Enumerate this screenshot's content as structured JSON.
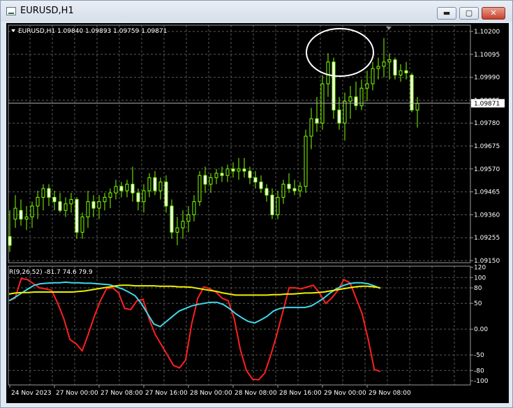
{
  "window": {
    "title": "EURUSD,H1",
    "minimize_label": "▬",
    "maximize_label": "▢",
    "close_label": "✕"
  },
  "icons": {
    "app": "chart-window-icon",
    "dropdown": "triangle-down-icon"
  },
  "colors": {
    "background": "#000000",
    "grid": "#5a5a5a",
    "candle": "#7fff00",
    "text": "#ffffff",
    "rsi_fast": "#ff2020",
    "rsi_mid": "#40d8e8",
    "rsi_slow": "#f0f000",
    "annotation": "#ffffff"
  },
  "main_chart": {
    "symbol_header": "EURUSD,H1  1.09840 1.09893 1.09759 1.09871",
    "current_price_label": "1.09871",
    "current_price": 1.09871,
    "price_labels": [
      "1.10200",
      "1.10095",
      "1.09990",
      "1.09885",
      "1.09780",
      "1.09675",
      "1.09570",
      "1.09465",
      "1.09360",
      "1.09255",
      "1.09150"
    ],
    "price_values": [
      1.102,
      1.10095,
      1.0999,
      1.09885,
      1.0978,
      1.09675,
      1.0957,
      1.09465,
      1.0936,
      1.09255,
      1.0915
    ],
    "ylim": [
      1.0915,
      1.102
    ]
  },
  "indicator": {
    "header": "R(9,26,52) -81.7 74.6 79.9",
    "level_labels": [
      "120",
      "100",
      "80",
      "50",
      "0.00",
      "-50",
      "-80",
      "-100"
    ],
    "level_values": [
      120,
      100,
      80,
      50,
      0,
      -50,
      -80,
      -100
    ],
    "ylim": [
      -108,
      122
    ]
  },
  "time_axis": {
    "labels": [
      "24 Nov 2023",
      "27 Nov 00:00",
      "27 Nov 08:00",
      "27 Nov 16:00",
      "28 Nov 00:00",
      "28 Nov 08:00",
      "28 Nov 16:00",
      "29 Nov 00:00",
      "29 Nov 08:00"
    ]
  },
  "chart_data": [
    {
      "type": "candlestick",
      "title": "EURUSD,H1",
      "ylim": [
        1.0915,
        1.102
      ],
      "candles": [
        {
          "o": 1.0926,
          "h": 1.0938,
          "l": 1.0919,
          "c": 1.0922
        },
        {
          "o": 1.0934,
          "h": 1.0945,
          "l": 1.093,
          "c": 1.0939
        },
        {
          "o": 1.0938,
          "h": 1.0943,
          "l": 1.0931,
          "c": 1.0934
        },
        {
          "o": 1.0934,
          "h": 1.094,
          "l": 1.0929,
          "c": 1.0935
        },
        {
          "o": 1.0935,
          "h": 1.0942,
          "l": 1.093,
          "c": 1.094
        },
        {
          "o": 1.094,
          "h": 1.0947,
          "l": 1.0934,
          "c": 1.0944
        },
        {
          "o": 1.0944,
          "h": 1.095,
          "l": 1.0938,
          "c": 1.0948
        },
        {
          "o": 1.0948,
          "h": 1.095,
          "l": 1.094,
          "c": 1.0944
        },
        {
          "o": 1.0944,
          "h": 1.0947,
          "l": 1.0938,
          "c": 1.0942
        },
        {
          "o": 1.0942,
          "h": 1.0946,
          "l": 1.0937,
          "c": 1.0938
        },
        {
          "o": 1.0938,
          "h": 1.0944,
          "l": 1.0935,
          "c": 1.0941
        },
        {
          "o": 1.0941,
          "h": 1.0946,
          "l": 1.0937,
          "c": 1.0943
        },
        {
          "o": 1.0943,
          "h": 1.0944,
          "l": 1.0925,
          "c": 1.0928
        },
        {
          "o": 1.0928,
          "h": 1.0937,
          "l": 1.0925,
          "c": 1.0935
        },
        {
          "o": 1.0935,
          "h": 1.0947,
          "l": 1.093,
          "c": 1.0942
        },
        {
          "o": 1.0942,
          "h": 1.0945,
          "l": 1.0935,
          "c": 1.0939
        },
        {
          "o": 1.0939,
          "h": 1.0945,
          "l": 1.0934,
          "c": 1.0942
        },
        {
          "o": 1.0942,
          "h": 1.0946,
          "l": 1.0938,
          "c": 1.0944
        },
        {
          "o": 1.0944,
          "h": 1.0948,
          "l": 1.0939,
          "c": 1.0946
        },
        {
          "o": 1.0946,
          "h": 1.0952,
          "l": 1.0943,
          "c": 1.0949
        },
        {
          "o": 1.0949,
          "h": 1.0951,
          "l": 1.0944,
          "c": 1.0947
        },
        {
          "o": 1.0947,
          "h": 1.0952,
          "l": 1.0944,
          "c": 1.095
        },
        {
          "o": 1.095,
          "h": 1.0958,
          "l": 1.0942,
          "c": 1.0946
        },
        {
          "o": 1.0946,
          "h": 1.0948,
          "l": 1.0938,
          "c": 1.0942
        },
        {
          "o": 1.0942,
          "h": 1.095,
          "l": 1.0937,
          "c": 1.0947
        },
        {
          "o": 1.0947,
          "h": 1.0955,
          "l": 1.0944,
          "c": 1.0953
        },
        {
          "o": 1.0953,
          "h": 1.0956,
          "l": 1.0945,
          "c": 1.0947
        },
        {
          "o": 1.0947,
          "h": 1.0953,
          "l": 1.0943,
          "c": 1.0951
        },
        {
          "o": 1.0951,
          "h": 1.0954,
          "l": 1.0937,
          "c": 1.094
        },
        {
          "o": 1.094,
          "h": 1.0943,
          "l": 1.0925,
          "c": 1.0928
        },
        {
          "o": 1.0928,
          "h": 1.0935,
          "l": 1.0922,
          "c": 1.093
        },
        {
          "o": 1.093,
          "h": 1.0938,
          "l": 1.0925,
          "c": 1.0933
        },
        {
          "o": 1.0933,
          "h": 1.094,
          "l": 1.0928,
          "c": 1.0936
        },
        {
          "o": 1.0936,
          "h": 1.0945,
          "l": 1.0933,
          "c": 1.0942
        },
        {
          "o": 1.0942,
          "h": 1.0956,
          "l": 1.094,
          "c": 1.0954
        },
        {
          "o": 1.0954,
          "h": 1.0958,
          "l": 1.0946,
          "c": 1.095
        },
        {
          "o": 1.095,
          "h": 1.0955,
          "l": 1.0946,
          "c": 1.0953
        },
        {
          "o": 1.0953,
          "h": 1.0957,
          "l": 1.095,
          "c": 1.0955
        },
        {
          "o": 1.0955,
          "h": 1.0958,
          "l": 1.0951,
          "c": 1.0954
        },
        {
          "o": 1.0954,
          "h": 1.0959,
          "l": 1.0951,
          "c": 1.0957
        },
        {
          "o": 1.0957,
          "h": 1.096,
          "l": 1.0953,
          "c": 1.0956
        },
        {
          "o": 1.0956,
          "h": 1.0962,
          "l": 1.0952,
          "c": 1.0957
        },
        {
          "o": 1.0957,
          "h": 1.0962,
          "l": 1.0953,
          "c": 1.0956
        },
        {
          "o": 1.0956,
          "h": 1.0958,
          "l": 1.095,
          "c": 1.0953
        },
        {
          "o": 1.0953,
          "h": 1.0956,
          "l": 1.0948,
          "c": 1.0951
        },
        {
          "o": 1.0951,
          "h": 1.0954,
          "l": 1.0946,
          "c": 1.0948
        },
        {
          "o": 1.0948,
          "h": 1.095,
          "l": 1.0942,
          "c": 1.0945
        },
        {
          "o": 1.0945,
          "h": 1.0948,
          "l": 1.0934,
          "c": 1.0936
        },
        {
          "o": 1.0936,
          "h": 1.0947,
          "l": 1.0934,
          "c": 1.0944
        },
        {
          "o": 1.0944,
          "h": 1.0952,
          "l": 1.0941,
          "c": 1.095
        },
        {
          "o": 1.095,
          "h": 1.0955,
          "l": 1.0946,
          "c": 1.0948
        },
        {
          "o": 1.0948,
          "h": 1.0952,
          "l": 1.0945,
          "c": 1.0947
        },
        {
          "o": 1.0947,
          "h": 1.0951,
          "l": 1.0944,
          "c": 1.0949
        },
        {
          "o": 1.0949,
          "h": 1.0975,
          "l": 1.0946,
          "c": 1.0972
        },
        {
          "o": 1.0972,
          "h": 1.0985,
          "l": 1.0966,
          "c": 1.098
        },
        {
          "o": 1.098,
          "h": 1.099,
          "l": 1.0974,
          "c": 1.0978
        },
        {
          "o": 1.0978,
          "h": 1.1,
          "l": 1.0975,
          "c": 1.0996
        },
        {
          "o": 1.0996,
          "h": 1.101,
          "l": 1.099,
          "c": 1.1006
        },
        {
          "o": 1.1006,
          "h": 1.1008,
          "l": 1.098,
          "c": 1.0984
        },
        {
          "o": 1.0984,
          "h": 1.099,
          "l": 1.0975,
          "c": 1.0978
        },
        {
          "o": 1.0978,
          "h": 1.0992,
          "l": 1.097,
          "c": 1.0988
        },
        {
          "o": 1.0988,
          "h": 1.0995,
          "l": 1.098,
          "c": 1.099
        },
        {
          "o": 1.099,
          "h": 1.0997,
          "l": 1.0984,
          "c": 1.0986
        },
        {
          "o": 1.0986,
          "h": 1.0998,
          "l": 1.0984,
          "c": 1.0994
        },
        {
          "o": 1.0994,
          "h": 1.1002,
          "l": 1.0988,
          "c": 1.0996
        },
        {
          "o": 1.0996,
          "h": 1.1006,
          "l": 1.0993,
          "c": 1.1003
        },
        {
          "o": 1.1003,
          "h": 1.1008,
          "l": 1.0998,
          "c": 1.1004
        },
        {
          "o": 1.1004,
          "h": 1.1017,
          "l": 1.0999,
          "c": 1.1006
        },
        {
          "o": 1.1006,
          "h": 1.101,
          "l": 1.0998,
          "c": 1.1007
        },
        {
          "o": 1.1007,
          "h": 1.1008,
          "l": 1.0998,
          "c": 1.1
        },
        {
          "o": 1.1,
          "h": 1.1005,
          "l": 1.0997,
          "c": 1.1002
        },
        {
          "o": 1.1002,
          "h": 1.1006,
          "l": 1.0998,
          "c": 1.1001
        },
        {
          "o": 1.1,
          "h": 1.1001,
          "l": 1.0983,
          "c": 1.0984
        },
        {
          "o": 1.0984,
          "h": 1.099,
          "l": 1.0976,
          "c": 1.0987
        }
      ]
    },
    {
      "type": "line",
      "title": "R(9,26,52)",
      "ylim": [
        -108,
        122
      ],
      "series": [
        {
          "name": "",
          "color": "#ff2020",
          "values": [
            55,
            60,
            98,
            96,
            88,
            80,
            78,
            75,
            50,
            20,
            -20,
            -28,
            -42,
            -10,
            25,
            55,
            78,
            80,
            70,
            40,
            38,
            55,
            58,
            20,
            -10,
            -30,
            -50,
            -70,
            -75,
            -60,
            10,
            60,
            82,
            78,
            72,
            60,
            55,
            20,
            -40,
            -80,
            -97,
            -98,
            -85,
            -50,
            -10,
            35,
            80,
            80,
            78,
            82,
            85,
            70,
            50,
            60,
            75,
            96,
            90,
            60,
            30,
            -20,
            -78,
            -82
          ]
        },
        {
          "name": "",
          "color": "#40d8e8",
          "values": [
            55,
            62,
            70,
            78,
            85,
            88,
            89,
            90,
            90,
            91,
            90,
            90,
            89,
            89,
            88,
            87,
            86,
            82,
            78,
            72,
            65,
            50,
            30,
            10,
            5,
            15,
            25,
            35,
            40,
            45,
            48,
            50,
            52,
            52,
            48,
            40,
            30,
            22,
            15,
            12,
            18,
            25,
            35,
            40,
            42,
            42,
            42,
            42,
            45,
            52,
            60,
            70,
            78,
            84,
            88,
            90,
            90,
            88,
            84,
            79
          ]
        },
        {
          "name": "",
          "color": "#f0f000",
          "values": [
            68,
            70,
            71,
            71,
            72,
            72,
            72,
            72,
            72,
            72,
            72,
            73,
            74,
            76,
            78,
            80,
            82,
            84,
            85,
            85,
            84,
            84,
            84,
            84,
            83,
            83,
            83,
            82,
            82,
            81,
            79,
            77,
            75,
            73,
            70,
            68,
            66,
            66,
            66,
            66,
            66,
            66,
            67,
            67,
            68,
            68,
            69,
            70,
            70,
            71,
            72,
            74,
            76,
            78,
            80,
            82,
            83,
            83,
            82,
            80
          ]
        }
      ]
    }
  ]
}
